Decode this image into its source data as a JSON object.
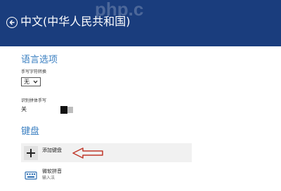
{
  "header": {
    "title": "中文(中华人民共和国)",
    "watermark": "php.c"
  },
  "language_options": {
    "heading": "语言选项",
    "handwriting_label": "手写字符转换",
    "handwriting_value": "无",
    "toggle_label": "识别拼体手写",
    "toggle_value": "关"
  },
  "keyboard": {
    "heading": "键盘",
    "add_keyboard_label": "添加键盘",
    "ime_name": "微软拼音",
    "ime_subtitle": "输入法"
  },
  "colors": {
    "header_bg": "#1a3d7d",
    "accent": "#3a7fc1",
    "annotation_arrow": "#c0392b"
  }
}
